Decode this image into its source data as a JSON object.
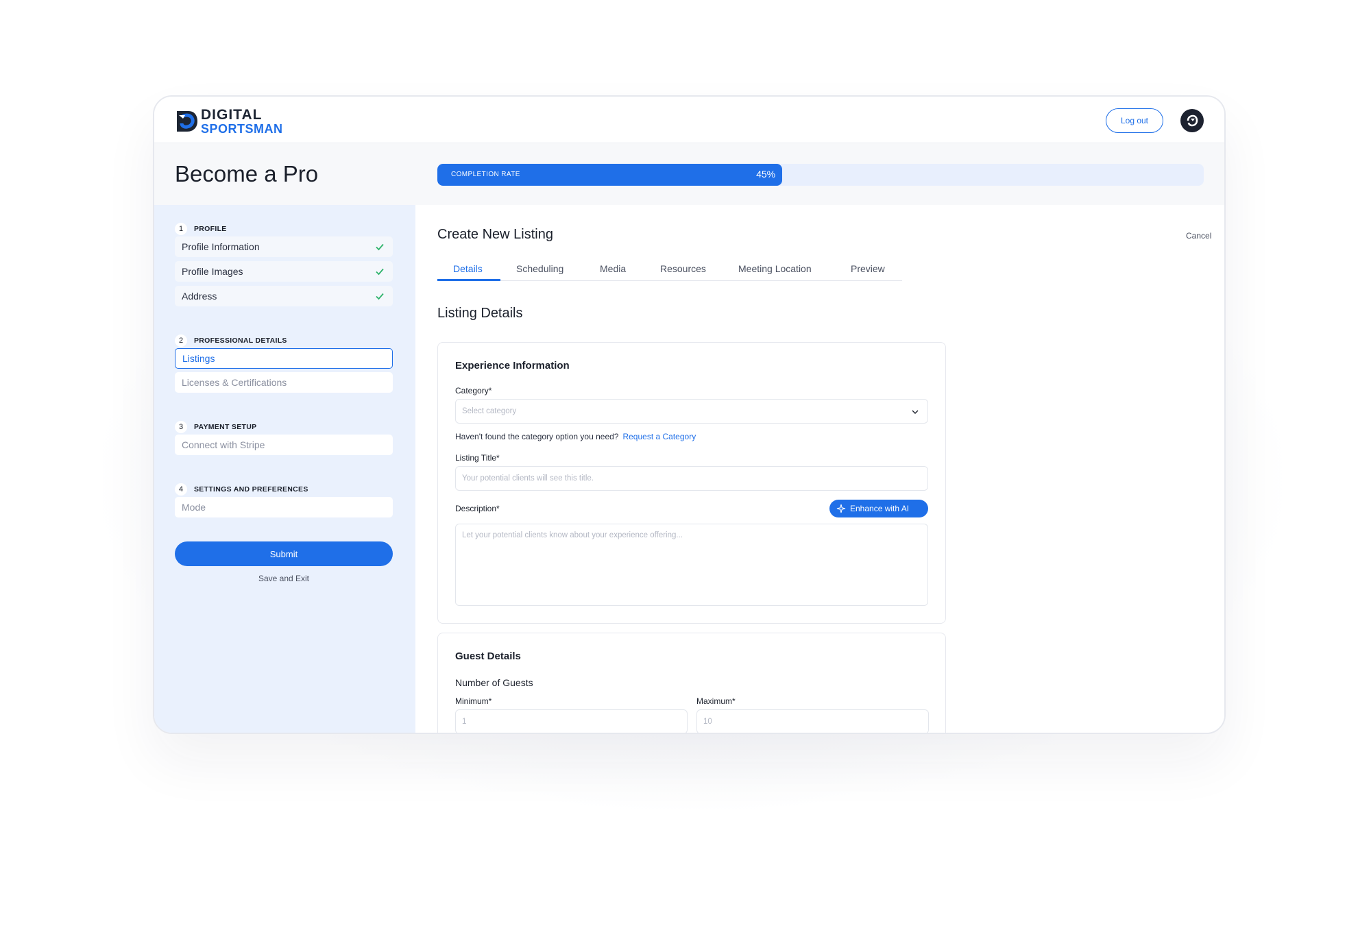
{
  "brand": {
    "line1": "DIGITAL",
    "line2": "SPORTSMAN"
  },
  "header": {
    "logout_label": "Log out"
  },
  "page": {
    "title": "Become a Pro",
    "progress_label": "COMPLETION RATE",
    "progress_value": 0.45,
    "progress_text": "45%"
  },
  "sidebar": {
    "steps": [
      {
        "num": "1",
        "title": "PROFILE",
        "items": [
          {
            "label": "Profile Information",
            "state": "done"
          },
          {
            "label": "Profile Images",
            "state": "done"
          },
          {
            "label": "Address",
            "state": "done"
          }
        ]
      },
      {
        "num": "2",
        "title": "PROFESSIONAL DETAILS",
        "items": [
          {
            "label": "Listings",
            "state": "active"
          },
          {
            "label": "Licenses & Certifications",
            "state": "pending"
          }
        ]
      },
      {
        "num": "3",
        "title": "PAYMENT SETUP",
        "items": [
          {
            "label": "Connect with Stripe",
            "state": "pending"
          }
        ]
      },
      {
        "num": "4",
        "title": "SETTINGS AND PREFERENCES",
        "items": [
          {
            "label": "Mode",
            "state": "pending"
          }
        ]
      }
    ],
    "submit_label": "Submit",
    "save_exit_label": "Save and Exit"
  },
  "main": {
    "title": "Create New Listing",
    "cancel_label": "Cancel",
    "tabs": [
      "Details",
      "Scheduling",
      "Media",
      "Resources",
      "Meeting Location",
      "Preview"
    ],
    "active_tab": "Details",
    "section_title": "Listing Details",
    "experience": {
      "title": "Experience Information",
      "category_label": "Category*",
      "category_placeholder": "Select category",
      "helper_text": "Haven't found the category option you need?",
      "helper_link": "Request a Category",
      "listing_title_label": "Listing Title*",
      "listing_title_placeholder": "Your potential clients will see this title.",
      "description_label": "Description*",
      "enhance_label": "Enhance with AI",
      "description_placeholder": "Let your potential clients know about your experience offering..."
    },
    "guests": {
      "title": "Guest Details",
      "subtitle": "Number of Guests",
      "min_label": "Minimum*",
      "min_placeholder": "1",
      "max_label": "Maximum*",
      "max_placeholder": "10"
    }
  },
  "colors": {
    "accent": "#1f6fe8",
    "sidebar_bg": "#eaf1fd",
    "success": "#2fb36b"
  }
}
